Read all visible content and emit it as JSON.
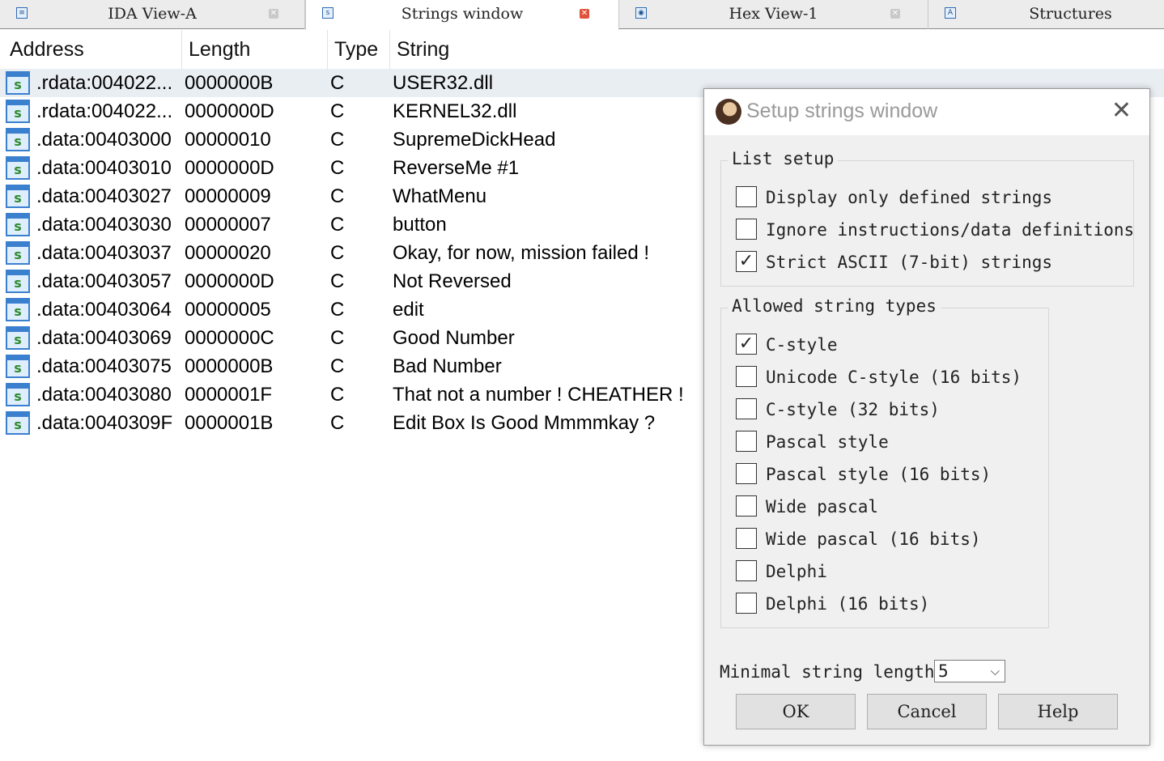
{
  "tabs": [
    {
      "label": "IDA View-A",
      "icon": "ida-view-icon",
      "active": false
    },
    {
      "label": "Strings window",
      "icon": "strings-icon",
      "active": true
    },
    {
      "label": "Hex View-1",
      "icon": "hex-view-icon",
      "active": false
    },
    {
      "label": "Structures",
      "icon": "structures-icon",
      "active": false
    }
  ],
  "table": {
    "headers": {
      "address": "Address",
      "length": "Length",
      "type": "Type",
      "string": "String"
    },
    "rows": [
      {
        "address": ".rdata:004022...",
        "length": "0000000B",
        "type": "C",
        "string": "USER32.dll"
      },
      {
        "address": ".rdata:004022...",
        "length": "0000000D",
        "type": "C",
        "string": "KERNEL32.dll"
      },
      {
        "address": ".data:00403000",
        "length": "00000010",
        "type": "C",
        "string": "SupremeDickHead"
      },
      {
        "address": ".data:00403010",
        "length": "0000000D",
        "type": "C",
        "string": "ReverseMe #1"
      },
      {
        "address": ".data:00403027",
        "length": "00000009",
        "type": "C",
        "string": "WhatMenu"
      },
      {
        "address": ".data:00403030",
        "length": "00000007",
        "type": "C",
        "string": "button"
      },
      {
        "address": ".data:00403037",
        "length": "00000020",
        "type": "C",
        "string": "Okay, for now, mission failed !"
      },
      {
        "address": ".data:00403057",
        "length": "0000000D",
        "type": "C",
        "string": "Not Reversed"
      },
      {
        "address": ".data:00403064",
        "length": "00000005",
        "type": "C",
        "string": "edit"
      },
      {
        "address": ".data:00403069",
        "length": "0000000C",
        "type": "C",
        "string": "Good Number"
      },
      {
        "address": ".data:00403075",
        "length": "0000000B",
        "type": "C",
        "string": "Bad Number"
      },
      {
        "address": ".data:00403080",
        "length": "0000001F",
        "type": "C",
        "string": "That not a number ! CHEATHER !"
      },
      {
        "address": ".data:0040309F",
        "length": "0000001B",
        "type": "C",
        "string": "Edit Box Is Good Mmmmkay ?"
      }
    ],
    "row_icon_glyph": "s"
  },
  "dialog": {
    "title": "Setup strings window",
    "close_glyph": "✕",
    "list_setup": {
      "title": "List setup",
      "options": [
        {
          "label": "Display only defined strings",
          "checked": false
        },
        {
          "label": "Ignore instructions/data definitions",
          "checked": false
        },
        {
          "label": "Strict ASCII (7-bit) strings",
          "checked": true
        }
      ]
    },
    "allowed_types": {
      "title": "Allowed string types",
      "options": [
        {
          "label": "C-style",
          "checked": true
        },
        {
          "label": "Unicode C-style (16 bits)",
          "checked": false
        },
        {
          "label": "C-style (32 bits)",
          "checked": false
        },
        {
          "label": "Pascal style",
          "checked": false
        },
        {
          "label": "Pascal style (16 bits)",
          "checked": false
        },
        {
          "label": "Wide pascal",
          "checked": false
        },
        {
          "label": "Wide pascal (16 bits)",
          "checked": false
        },
        {
          "label": "Delphi",
          "checked": false
        },
        {
          "label": "Delphi (16 bits)",
          "checked": false
        }
      ]
    },
    "min_length_label": "Minimal string length",
    "min_length_value": "5",
    "buttons": {
      "ok": "OK",
      "cancel": "Cancel",
      "help": "Help"
    }
  }
}
